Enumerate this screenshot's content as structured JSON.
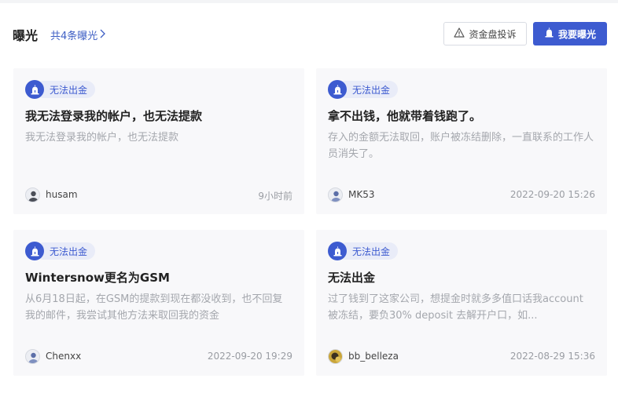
{
  "header": {
    "title": "曝光",
    "total_link": "共4条曝光",
    "complaint_button": "资金盘投诉",
    "expose_button": "我要曝光"
  },
  "cards": [
    {
      "tag": "无法出金",
      "title": "我无法登录我的帐户，也无法提款",
      "desc": "我无法登录我的帐户，也无法提款",
      "author": "husam",
      "time": "9小时前",
      "avatar": "default-avatar-icon"
    },
    {
      "tag": "无法出金",
      "title": "拿不出钱，他就带着钱跑了。",
      "desc": "存入的金额无法取回，账户被冻结删除，一直联系的工作人员消失了。",
      "author": "MK53",
      "time": "2022-09-20 15:26",
      "avatar": "default-avatar-icon"
    },
    {
      "tag": "无法出金",
      "title": "Wintersnow更名为GSM",
      "desc": "从6月18日起，在GSM的提款到现在都没收到，也不回复我的邮件，我尝试其他方法来取回我的资金",
      "author": "Chenxx",
      "time": "2022-09-20 19:29",
      "avatar": "default-avatar-icon"
    },
    {
      "tag": "无法出金",
      "title": "无法出金",
      "desc": "过了钱到了这家公司，想提金时就多多值口话我account 被冻结，要负30% deposit 去解开户口，如...",
      "author": "bb_belleza",
      "time": "2022-08-29 15:36",
      "avatar": "photo-avatar-icon"
    }
  ],
  "colors": {
    "accent": "#3d5bd0",
    "link": "#3d5ec4",
    "tag_bg": "#e9ecf8",
    "card_bg": "#f8f8fa",
    "muted_text": "#a4a7ad"
  }
}
